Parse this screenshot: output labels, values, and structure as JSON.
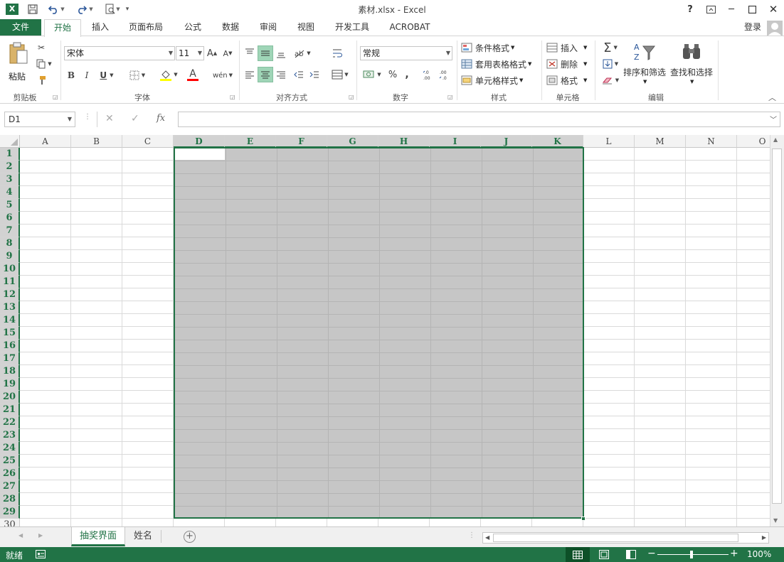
{
  "window": {
    "title": "素材.xlsx - Excel",
    "help": "?",
    "login": "登录"
  },
  "tabs": {
    "file": "文件",
    "home": "开始",
    "insert": "插入",
    "layout": "页面布局",
    "formulas": "公式",
    "data": "数据",
    "review": "审阅",
    "view": "视图",
    "developer": "开发工具",
    "acrobat": "ACROBAT"
  },
  "ribbon": {
    "clipboard": {
      "paste": "粘贴",
      "label": "剪贴板"
    },
    "font": {
      "name": "宋体",
      "size": "11",
      "bold": "B",
      "italic": "I",
      "underline": "U",
      "grow": "A",
      "shrink": "A",
      "font_color": "A",
      "phonetic": "wén",
      "label": "字体"
    },
    "alignment": {
      "label": "对齐方式"
    },
    "number": {
      "format": "常规",
      "percent": "%",
      "comma": ",",
      "label": "数字"
    },
    "styles": {
      "conditional": "条件格式",
      "table": "套用表格格式",
      "cell_styles": "单元格样式",
      "label": "样式"
    },
    "cells": {
      "insert": "插入",
      "delete": "删除",
      "format": "格式",
      "label": "单元格"
    },
    "editing": {
      "sort": "排序和筛选",
      "find": "查找和选择",
      "label": "编辑"
    }
  },
  "formula": {
    "name_box": "D1",
    "fx": "fx",
    "value": ""
  },
  "columns": [
    "A",
    "B",
    "C",
    "D",
    "E",
    "F",
    "G",
    "H",
    "I",
    "J",
    "K",
    "L",
    "M",
    "N",
    "O"
  ],
  "rows": [
    "1",
    "2",
    "3",
    "4",
    "5",
    "6",
    "7",
    "8",
    "9",
    "10",
    "11",
    "12",
    "13",
    "14",
    "15",
    "16",
    "17",
    "18",
    "19",
    "20",
    "21",
    "22",
    "23",
    "24",
    "25",
    "26",
    "27",
    "28",
    "29",
    "30"
  ],
  "selection": {
    "range": "D1:K29",
    "active": "D1"
  },
  "sheets": [
    "抽奖界面",
    "姓名"
  ],
  "status": {
    "ready": "就绪",
    "zoom": "100%"
  },
  "colors": {
    "accent": "#217346",
    "selection_fill": "#c6c6c6",
    "highlight": "#9fd5b7"
  },
  "icons": [
    "excel-logo-icon",
    "save-icon",
    "undo-icon",
    "redo-icon",
    "print-preview-icon",
    "customize-icon",
    "help-icon",
    "ribbon-display-icon",
    "minimize-icon",
    "maximize-icon",
    "close-icon",
    "user-icon",
    "cut-icon",
    "copy-icon",
    "format-painter-icon",
    "border-icon",
    "fill-color-icon",
    "orientation-icon",
    "wrap-text-icon",
    "merge-icon",
    "currency-icon",
    "increase-decimal-icon",
    "decrease-decimal-icon",
    "sum-icon",
    "fill-icon",
    "clear-icon",
    "sort-filter-icon",
    "find-icon",
    "cancel-icon",
    "enter-icon",
    "add-sheet-icon",
    "normal-view-icon",
    "page-layout-icon",
    "page-break-icon",
    "macro-icon"
  ]
}
